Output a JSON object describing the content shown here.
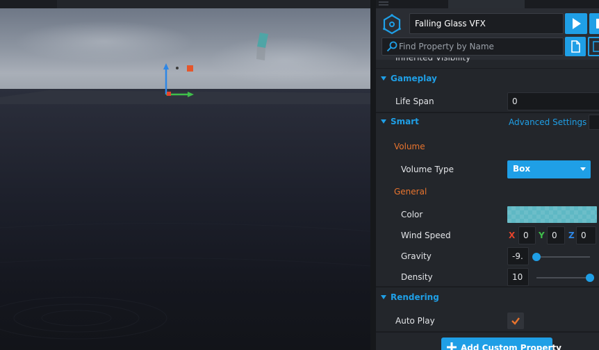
{
  "viewport": {},
  "panel": {
    "object_name": "Falling Glass VFX",
    "search_placeholder": "Find Property by Name",
    "inherited_visibility_label": "Inherited Visibility",
    "gameplay": {
      "title": "Gameplay",
      "life_span_label": "Life Span",
      "life_span_value": "0"
    },
    "smart": {
      "title": "Smart",
      "advanced_settings_label": "Advanced Settings",
      "volume_heading": "Volume",
      "volume_type_label": "Volume Type",
      "volume_type_value": "Box",
      "general_heading": "General",
      "color_label": "Color",
      "color_value": "#5fb8c4",
      "wind_speed_label": "Wind Speed",
      "wind_x_label": "X",
      "wind_x_value": "0",
      "wind_y_label": "Y",
      "wind_y_value": "0",
      "wind_z_label": "Z",
      "wind_z_value": "0",
      "gravity_label": "Gravity",
      "gravity_value": "-9.",
      "gravity_slider_level": 0.0,
      "density_label": "Density",
      "density_value": "10",
      "density_slider_level": 1.0
    },
    "rendering": {
      "title": "Rendering",
      "auto_play_label": "Auto Play",
      "auto_play_checked": true
    },
    "add_custom_property_label": "Add Custom Property"
  },
  "colors": {
    "accent_blue": "#1f9fe6",
    "accent_orange": "#e8742e",
    "axis_x": "#e5432b",
    "axis_y": "#3fbf4a",
    "axis_z": "#2d86e5"
  }
}
